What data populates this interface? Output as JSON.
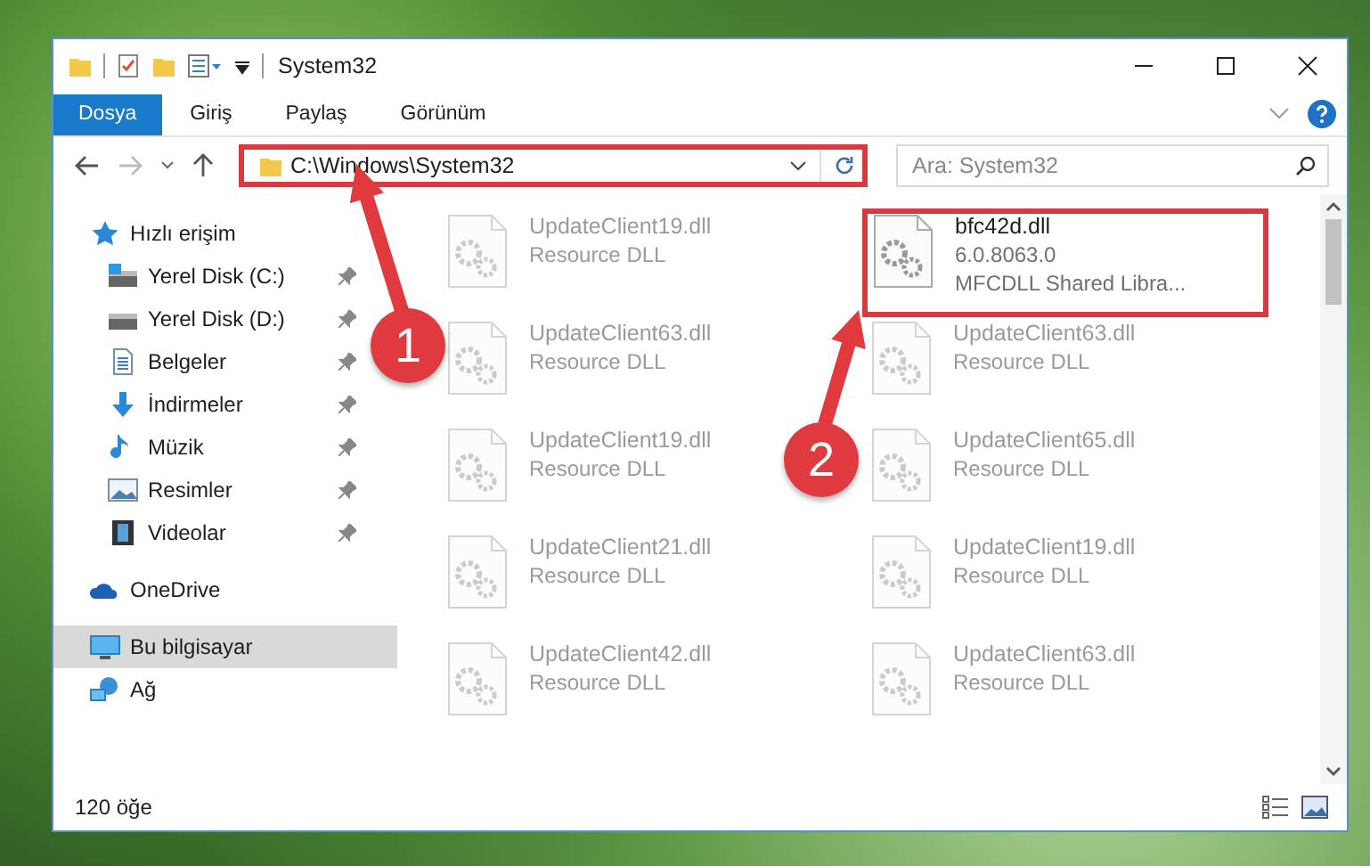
{
  "window": {
    "title": "System32"
  },
  "ribbon": {
    "tabs": [
      {
        "label": "Dosya",
        "selected": true
      },
      {
        "label": "Giriş",
        "selected": false
      },
      {
        "label": "Paylaş",
        "selected": false
      },
      {
        "label": "Görünüm",
        "selected": false
      }
    ]
  },
  "address": {
    "path": "C:\\Windows\\System32",
    "highlighted": true
  },
  "search": {
    "placeholder": "Ara: System32"
  },
  "sidebar": {
    "items": [
      {
        "label": "Hızlı erişim",
        "kind": "star",
        "selected": false,
        "children": [
          {
            "label": "Yerel Disk (C:)",
            "kind": "drive-c",
            "pinned": true,
            "selected": false
          },
          {
            "label": "Yerel Disk (D:)",
            "kind": "drive",
            "pinned": true,
            "selected": false
          },
          {
            "label": "Belgeler",
            "kind": "documents",
            "pinned": true,
            "selected": false
          },
          {
            "label": "İndirmeler",
            "kind": "downloads",
            "pinned": true,
            "selected": false
          },
          {
            "label": "Müzik",
            "kind": "music",
            "pinned": true,
            "selected": false
          },
          {
            "label": "Resimler",
            "kind": "pictures",
            "pinned": true,
            "selected": false
          },
          {
            "label": "Videolar",
            "kind": "videos",
            "pinned": true,
            "selected": false
          }
        ]
      },
      {
        "label": "OneDrive",
        "kind": "cloud",
        "selected": false
      },
      {
        "label": "Bu bilgisayar",
        "kind": "computer",
        "selected": true
      },
      {
        "label": "Ağ",
        "kind": "network",
        "selected": false
      }
    ]
  },
  "files": [
    {
      "name": "UpdateClient19.dll",
      "details": [
        "Resource DLL"
      ],
      "dimmed": true,
      "highlighted": false
    },
    {
      "name": "bfc42d.dll",
      "details": [
        "6.0.8063.0",
        "MFCDLL Shared Libra..."
      ],
      "dimmed": false,
      "highlighted": true
    },
    {
      "name": "UpdateClient63.dll",
      "details": [
        "Resource DLL"
      ],
      "dimmed": true,
      "highlighted": false
    },
    {
      "name": "UpdateClient63.dll",
      "details": [
        "Resource DLL"
      ],
      "dimmed": true,
      "highlighted": false
    },
    {
      "name": "UpdateClient19.dll",
      "details": [
        "Resource DLL"
      ],
      "dimmed": true,
      "highlighted": false
    },
    {
      "name": "UpdateClient65.dll",
      "details": [
        "Resource DLL"
      ],
      "dimmed": true,
      "highlighted": false
    },
    {
      "name": "UpdateClient21.dll",
      "details": [
        "Resource DLL"
      ],
      "dimmed": true,
      "highlighted": false
    },
    {
      "name": "UpdateClient19.dll",
      "details": [
        "Resource DLL"
      ],
      "dimmed": true,
      "highlighted": false
    },
    {
      "name": "UpdateClient42.dll",
      "details": [
        "Resource DLL"
      ],
      "dimmed": true,
      "highlighted": false
    },
    {
      "name": "UpdateClient63.dll",
      "details": [
        "Resource DLL"
      ],
      "dimmed": true,
      "highlighted": false
    }
  ],
  "status_bar": {
    "item_count": "120 öğe"
  },
  "callouts": [
    {
      "label": "1"
    },
    {
      "label": "2"
    }
  ]
}
